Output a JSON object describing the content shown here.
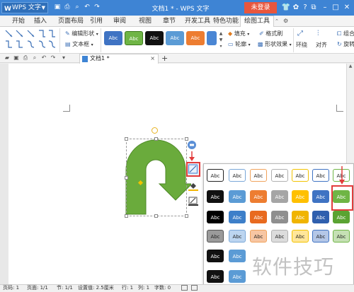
{
  "titlebar": {
    "app_label": "WPS 文字",
    "app_logo": "W",
    "doc_title": "文档1 * - WPS 文字",
    "login_label": "未登录",
    "bg_color": "#3e84d4",
    "login_color": "#e8563d",
    "quick_icons": [
      "save-icon",
      "print-icon",
      "preview-icon",
      "undo-icon",
      "redo-icon"
    ],
    "window_icons": [
      "shirt-icon",
      "skin-icon",
      "help-icon",
      "restore-icon",
      "minimize-icon",
      "maximize-icon",
      "close-icon"
    ]
  },
  "menu": {
    "tabs": [
      "开始",
      "插入",
      "页面布局",
      "引用",
      "审阅",
      "视图",
      "章节",
      "开发工具",
      "特色功能",
      "绘图工具"
    ],
    "active": "绘图工具"
  },
  "ribbon": {
    "edit_shape": "编辑形状",
    "text_box": "文本框",
    "style_buttons": [
      {
        "label": "Abc",
        "color": "#3f73c3"
      },
      {
        "label": "Abc",
        "color": "#6fb545"
      },
      {
        "label": "Abc",
        "color": "#111111"
      },
      {
        "label": "Abc",
        "color": "#5b9bd5"
      },
      {
        "label": "Abc",
        "color": "#ed7d31"
      },
      {
        "label": "Abc",
        "color": "#4a86d4"
      }
    ],
    "fill": "填充",
    "format_brush": "格式刷",
    "outline": "轮廓",
    "shape_effect": "形状效果",
    "wrap": "环绕",
    "align": "对齐",
    "rotate": "旋转",
    "group": "组合"
  },
  "toolbar2": {
    "doc_tab": "文档1 *",
    "add_tab": "+"
  },
  "floating_tools": {
    "layout": "layout-options-icon",
    "style": "shape-style-icon",
    "fill": "fill-bucket-icon",
    "outline": "outline-pen-icon"
  },
  "style_panel": {
    "rows": [
      [
        {
          "label": "Abc",
          "bg": "#ffffff",
          "fg": "#222222",
          "border": "#222222"
        },
        {
          "label": "Abc",
          "bg": "#ffffff",
          "fg": "#222222",
          "border": "#7aa7d8"
        },
        {
          "label": "Abc",
          "bg": "#ffffff",
          "fg": "#222222",
          "border": "#f0a35c"
        },
        {
          "label": "Abc",
          "bg": "#ffffff",
          "fg": "#222222",
          "border": "#b0b0b0"
        },
        {
          "label": "Abc",
          "bg": "#ffffff",
          "fg": "#222222",
          "border": "#f2c200"
        },
        {
          "label": "Abc",
          "bg": "#ffffff",
          "fg": "#222222",
          "border": "#3f73c3"
        },
        {
          "label": "Abc",
          "bg": "#ffffff",
          "fg": "#222222",
          "border": "#6fb545"
        }
      ],
      [
        {
          "label": "Abc",
          "bg": "#111111",
          "fg": "#ffffff",
          "border": "#111111"
        },
        {
          "label": "Abc",
          "bg": "#5b9bd5",
          "fg": "#ffffff",
          "border": "#5b9bd5"
        },
        {
          "label": "Abc",
          "bg": "#ed7d31",
          "fg": "#ffffff",
          "border": "#ed7d31"
        },
        {
          "label": "Abc",
          "bg": "#a5a5a5",
          "fg": "#ffffff",
          "border": "#a5a5a5"
        },
        {
          "label": "Abc",
          "bg": "#ffc000",
          "fg": "#ffffff",
          "border": "#ffc000"
        },
        {
          "label": "Abc",
          "bg": "#3f73c3",
          "fg": "#ffffff",
          "border": "#3f73c3"
        },
        {
          "label": "Abc",
          "bg": "#6fb545",
          "fg": "#ffffff",
          "border": "#6fb545"
        }
      ],
      [
        {
          "label": "Abc",
          "bg": "#000000",
          "fg": "#ffffff",
          "border": "#000000"
        },
        {
          "label": "Abc",
          "bg": "#3d7fc9",
          "fg": "#ffffff",
          "border": "#3d7fc9"
        },
        {
          "label": "Abc",
          "bg": "#e86a1f",
          "fg": "#ffffff",
          "border": "#e86a1f"
        },
        {
          "label": "Abc",
          "bg": "#8f8f8f",
          "fg": "#ffffff",
          "border": "#8f8f8f"
        },
        {
          "label": "Abc",
          "bg": "#f0b400",
          "fg": "#ffffff",
          "border": "#f0b400"
        },
        {
          "label": "Abc",
          "bg": "#2f5fae",
          "fg": "#ffffff",
          "border": "#2f5fae"
        },
        {
          "label": "Abc",
          "bg": "#5aa332",
          "fg": "#ffffff",
          "border": "#5aa332"
        }
      ],
      [
        {
          "label": "Abc",
          "bg": "#9a9a9a",
          "fg": "#222222",
          "border": "#555555"
        },
        {
          "label": "Abc",
          "bg": "#bcd5f0",
          "fg": "#222222",
          "border": "#7aa7d8"
        },
        {
          "label": "Abc",
          "bg": "#f7c6a3",
          "fg": "#222222",
          "border": "#f0a35c"
        },
        {
          "label": "Abc",
          "bg": "#dcdcdc",
          "fg": "#222222",
          "border": "#b0b0b0"
        },
        {
          "label": "Abc",
          "bg": "#ffe699",
          "fg": "#222222",
          "border": "#f2c200"
        },
        {
          "label": "Abc",
          "bg": "#b4c7e7",
          "fg": "#222222",
          "border": "#3f73c3"
        },
        {
          "label": "Abc",
          "bg": "#c5e0b4",
          "fg": "#222222",
          "border": "#6fb545"
        }
      ],
      [
        {
          "label": "Abc",
          "bg": "#111111",
          "fg": "#ffffff",
          "border": "#111111"
        },
        {
          "label": "Abc",
          "bg": "#5b9bd5",
          "fg": "#ffffff",
          "border": "#5b9bd5"
        }
      ],
      [
        {
          "label": "Abc",
          "bg": "#111111",
          "fg": "#ffffff",
          "border": "#111111"
        },
        {
          "label": "Abc",
          "bg": "#5b9bd5",
          "fg": "#ffffff",
          "border": "#5b9bd5"
        }
      ]
    ],
    "selected": "green-abc-row2"
  },
  "watermark": "软件技巧",
  "statusbar": {
    "page_num": "页码: 1",
    "pages": "页面: 1/1",
    "section": "节: 1/1",
    "position": "设置值: 2.5厘米",
    "row": "行: 1",
    "col": "列: 1",
    "words": "字数: 0"
  },
  "shape": {
    "color": "#6aab3c",
    "type": "u-turn-arrow"
  }
}
